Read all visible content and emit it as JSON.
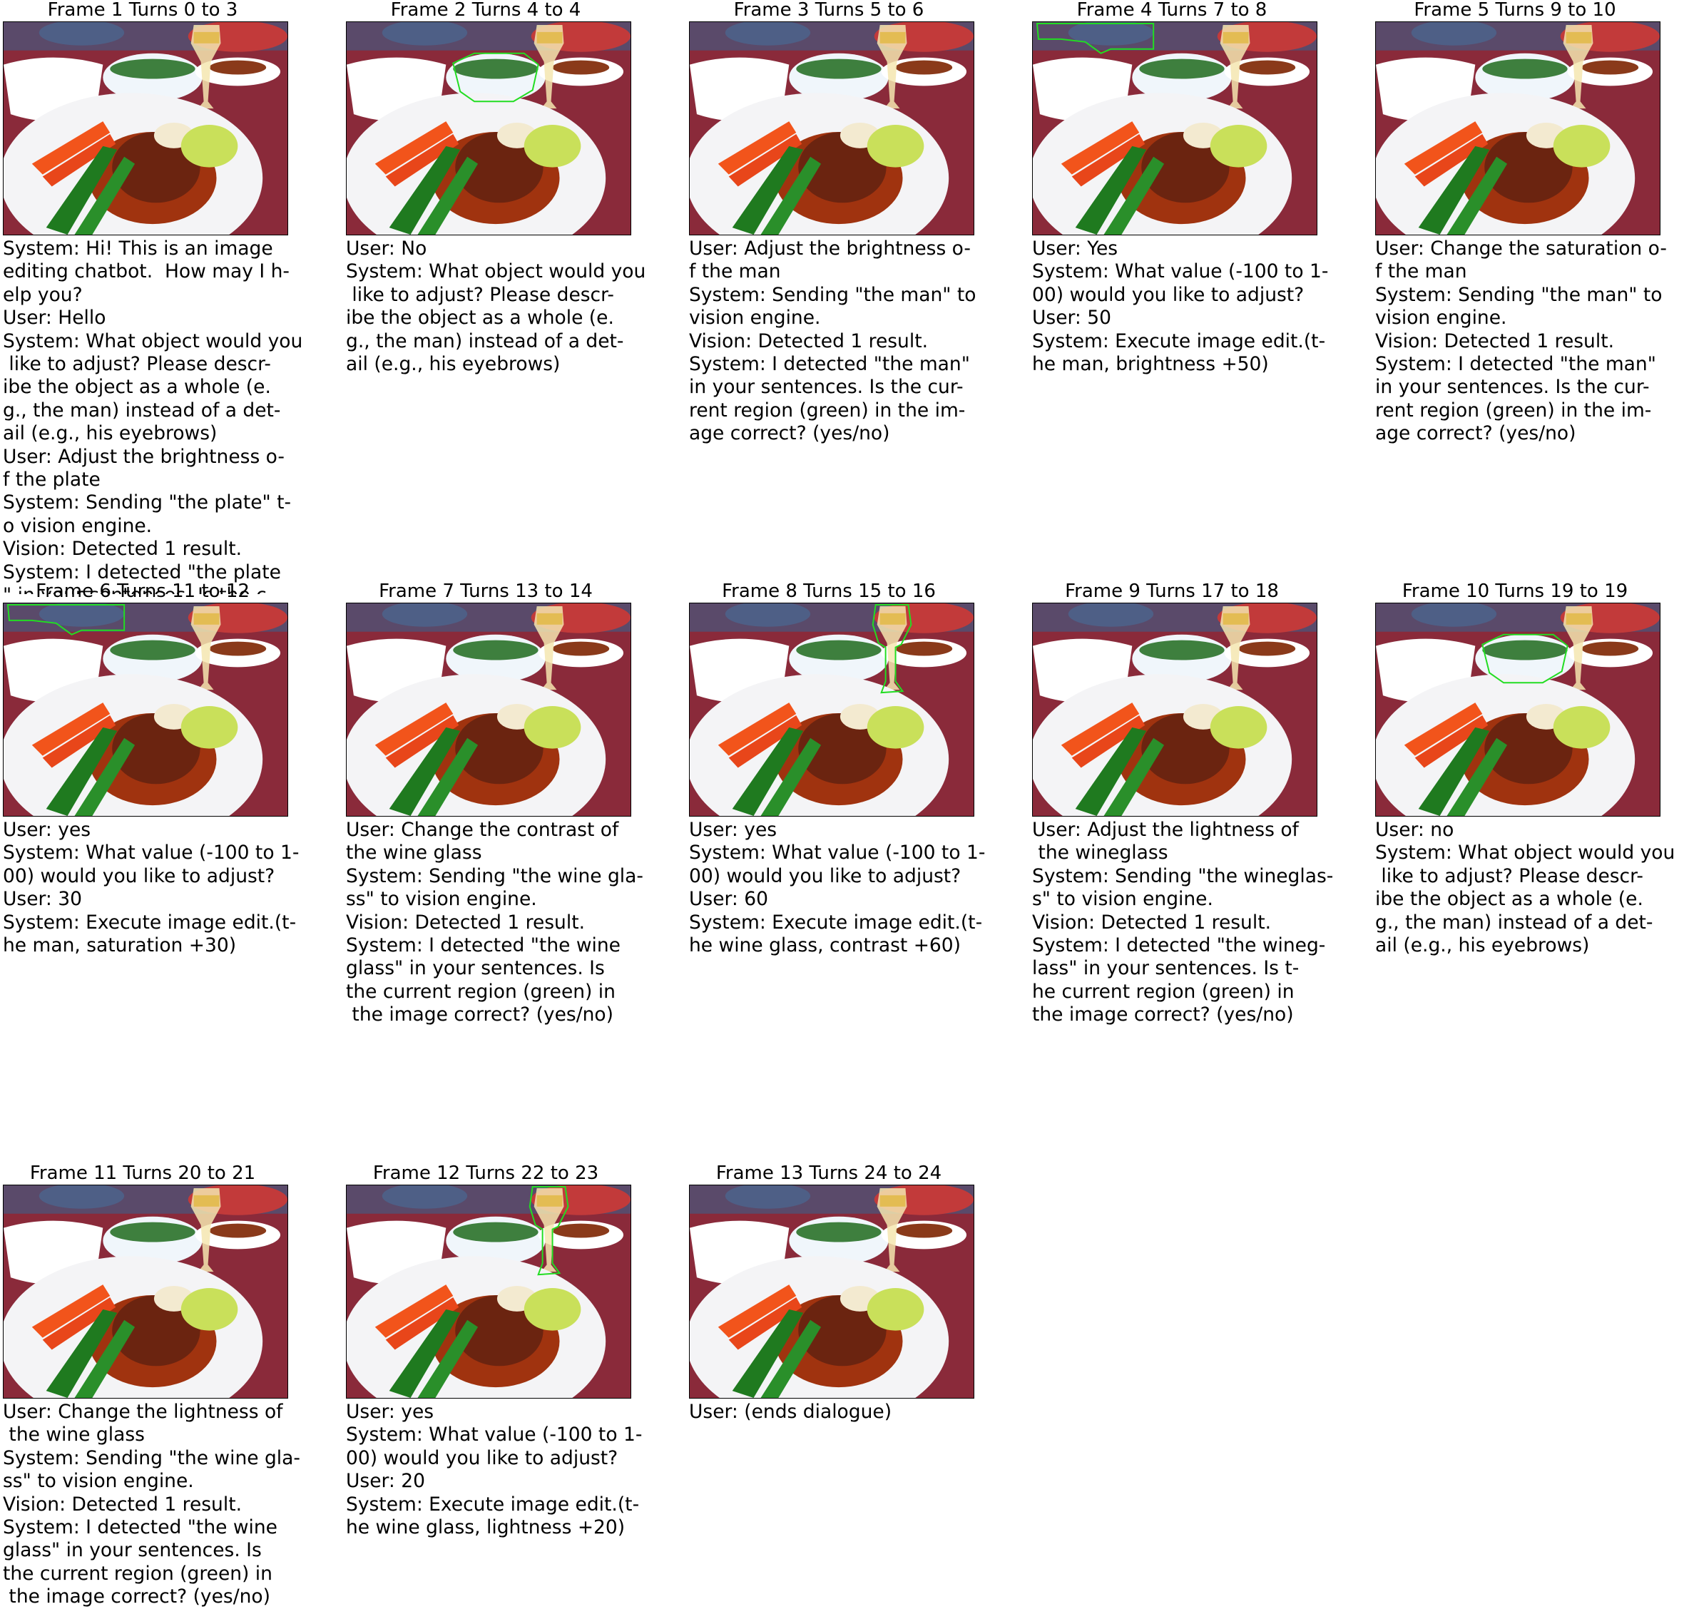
{
  "frames": [
    {
      "title": "Frame 1 Turns 0 to 3",
      "highlight": "none",
      "text": "System: Hi! This is an image\nediting chatbot.  How may I h-\nelp you?\nUser: Hello\nSystem: What object would you\n like to adjust? Please descr-\nibe the object as a whole (e.\ng., the man) instead of a det-\nail (e.g., his eyebrows)\nUser: Adjust the brightness o-\nf the plate\nSystem: Sending \"the plate\" t-\no vision engine.\nVision: Detected 1 result.\nSystem: I detected \"the plate\n\" in your sentences. Is the c-"
    },
    {
      "title": "Frame 2 Turns 4 to 4",
      "highlight": "bowl",
      "text": "User: No\nSystem: What object would you\n like to adjust? Please descr-\nibe the object as a whole (e.\ng., the man) instead of a det-\nail (e.g., his eyebrows)"
    },
    {
      "title": "Frame 3 Turns 5 to 6",
      "highlight": "none",
      "text": "User: Adjust the brightness o-\nf the man\nSystem: Sending \"the man\" to\nvision engine.\nVision: Detected 1 result.\nSystem: I detected \"the man\"\nin your sentences. Is the cur-\nrent region (green) in the im-\nage correct? (yes/no)"
    },
    {
      "title": "Frame 4 Turns 7 to 8",
      "highlight": "man",
      "text": "User: Yes\nSystem: What value (-100 to 1-\n00) would you like to adjust?\nUser: 50\nSystem: Execute image edit.(t-\nhe man, brightness +50)"
    },
    {
      "title": "Frame 5 Turns 9 to 10",
      "highlight": "none",
      "text": "User: Change the saturation o-\nf the man\nSystem: Sending \"the man\" to\nvision engine.\nVision: Detected 1 result.\nSystem: I detected \"the man\"\nin your sentences. Is the cur-\nrent region (green) in the im-\nage correct? (yes/no)"
    },
    {
      "title": "Frame 6 Turns 11 to 12",
      "highlight": "man",
      "text": "User: yes\nSystem: What value (-100 to 1-\n00) would you like to adjust?\nUser: 30\nSystem: Execute image edit.(t-\nhe man, saturation +30)"
    },
    {
      "title": "Frame 7 Turns 13 to 14",
      "highlight": "none",
      "text": "User: Change the contrast of\nthe wine glass\nSystem: Sending \"the wine gla-\nss\" to vision engine.\nVision: Detected 1 result.\nSystem: I detected \"the wine\nglass\" in your sentences. Is\nthe current region (green) in\n the image correct? (yes/no)"
    },
    {
      "title": "Frame 8 Turns 15 to 16",
      "highlight": "glass",
      "text": "User: yes\nSystem: What value (-100 to 1-\n00) would you like to adjust?\nUser: 60\nSystem: Execute image edit.(t-\nhe wine glass, contrast +60)"
    },
    {
      "title": "Frame 9 Turns 17 to 18",
      "highlight": "none",
      "text": "User: Adjust the lightness of\n the wineglass\nSystem: Sending \"the wineglas-\ns\" to vision engine.\nVision: Detected 1 result.\nSystem: I detected \"the wineg-\nlass\" in your sentences. Is t-\nhe current region (green) in\nthe image correct? (yes/no)"
    },
    {
      "title": "Frame 10 Turns 19 to 19",
      "highlight": "bowl",
      "text": "User: no\nSystem: What object would you\n like to adjust? Please descr-\nibe the object as a whole (e.\ng., the man) instead of a det-\nail (e.g., his eyebrows)"
    },
    {
      "title": "Frame 11 Turns 20 to 21",
      "highlight": "none",
      "text": "User: Change the lightness of\n the wine glass\nSystem: Sending \"the wine gla-\nss\" to vision engine.\nVision: Detected 1 result.\nSystem: I detected \"the wine\nglass\" in your sentences. Is\nthe current region (green) in\n the image correct? (yes/no)"
    },
    {
      "title": "Frame 12 Turns 22 to 23",
      "highlight": "glass",
      "text": "User: yes\nSystem: What value (-100 to 1-\n00) would you like to adjust?\nUser: 20\nSystem: Execute image edit.(t-\nhe wine glass, lightness +20)"
    },
    {
      "title": "Frame 13 Turns 24 to 24",
      "highlight": "none",
      "text": "User: (ends dialogue)"
    }
  ],
  "colors": {
    "highlight": "#22dd22",
    "plate": "#f4f4f6",
    "carrot": "#f2541b",
    "beans": "#1f7a1f",
    "meat": "#6b2410",
    "sauce": "#a0330f",
    "lettuce": "#c9e05a",
    "tablecloth": "#8a2a3a",
    "bowl": "#f0f6fb"
  }
}
